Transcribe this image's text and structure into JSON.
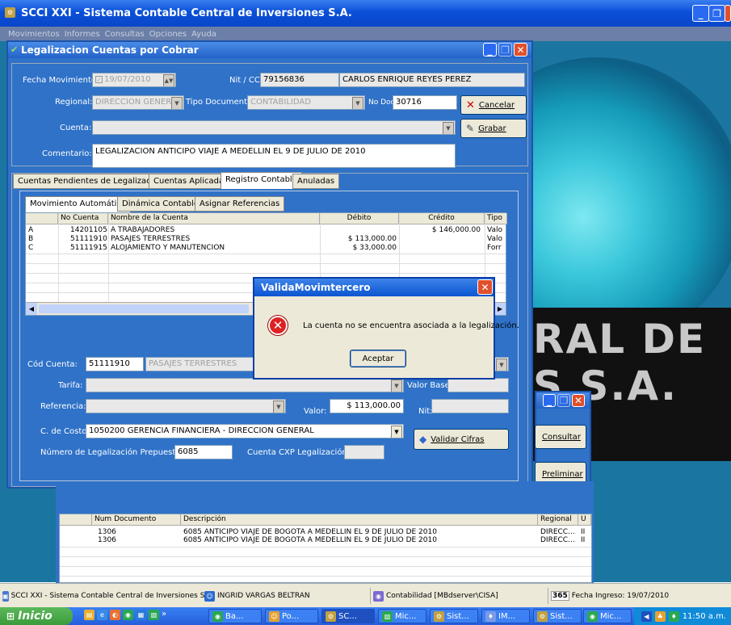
{
  "app_title": "SCCI XXI - Sistema Contable Central de Inversiones S.A.",
  "menu": [
    "Movimientos",
    "Informes",
    "Consultas",
    "Opciones",
    "Ayuda"
  ],
  "background_text": {
    "line1": "RAL DE",
    "line2": "S S.A."
  },
  "legal_window": {
    "title": "Legalizacion Cuentas por Cobrar",
    "fecha_label": "Fecha Movimiento:",
    "fecha_value": "19/07/2010",
    "nit_label": "Nit / CC:",
    "nit_value": "79156836",
    "nombre_value": "CARLOS ENRIQUE REYES PEREZ",
    "regional_label": "Regional:",
    "regional_value": "DIRECCION GENERAL",
    "tipo_doc_label": "Tipo Documento:",
    "tipo_doc_value": "CONTABILIDAD",
    "no_doc_label": "No Doc.",
    "no_doc_value": "30716",
    "cancelar_label": "Cancelar",
    "cuenta_label": "Cuenta:",
    "grabar_label": "Grabar",
    "comentario_label": "Comentario:",
    "comentario_value": "LEGALIZACION ANTICIPO VIAJE A MEDELLIN EL 9 DE JULIO DE 2010",
    "tabs": [
      "Cuentas Pendientes de Legalización",
      "Cuentas Aplicadas",
      "Registro Contable",
      "Anuladas"
    ],
    "subtabs": [
      "Movimiento Automático",
      "Dinámica Contable",
      "Asignar Referencias"
    ],
    "grid": {
      "headers": [
        "",
        "No Cuenta",
        "Nombre de la Cuenta",
        "Débito",
        "Crédito",
        "Tipo"
      ],
      "rows": [
        [
          "A",
          "14201105",
          "A TRABAJADORES",
          "",
          "$ 146,000.00",
          "Valo"
        ],
        [
          "B",
          "51111910",
          "PASAJES TERRESTRES",
          "$ 113,000.00",
          "",
          "Valo"
        ],
        [
          "C",
          "51111915",
          "ALOJAMIENTO Y MANUTENCION",
          "$ 33,000.00",
          "",
          "Forr"
        ]
      ]
    },
    "cod_cuenta_label": "Cód Cuenta:",
    "cod_cuenta_value": "51111910",
    "cod_cuenta_name": "PASAJES TERRESTRES",
    "tarifa_label": "Tarifa:",
    "valor_base_label": "Valor Base:",
    "referencia_label": "Referencia:",
    "valor_label": "Valor:",
    "valor_value": "$ 113,000.00",
    "nit2_label": "Nit:",
    "costo_label": "C. de Costo:",
    "costo_value": "1050200 GERENCIA FINANCIERA - DIRECCION GENERAL",
    "validar_label": "Validar Cifras",
    "num_legal_label": "Número de Legalización Prepuestal:",
    "num_legal_value": "6085",
    "cxp_label": "Cuenta CXP Legalización:"
  },
  "dialog": {
    "title": "ValidaMovimtercero",
    "message": "La cuenta no se encuentra asociada a la legalización.",
    "ok_label": "Aceptar"
  },
  "win2": {
    "consultar_label": "Consultar",
    "preliminar_label": "Preliminar"
  },
  "bottom_grid": {
    "headers": [
      "",
      "Num Documento",
      "Descripción",
      "Regional",
      "U"
    ],
    "rows": [
      [
        "1306",
        "6085 ANTICIPO VIAJE DE BOGOTA A MEDELLIN EL 9 DE JULIO DE 2010",
        "DIRECC...",
        "II"
      ],
      [
        "1306",
        "6085 ANTICIPO VIAJE DE BOGOTA A MEDELLIN EL 9 DE JULIO DE 2010",
        "DIRECC...",
        "II"
      ]
    ]
  },
  "statusbar": {
    "app": "SCCI XXI - Sistema Contable Central de Inversiones S",
    "user": "INGRID VARGAS BELTRAN",
    "db": "Contabilidad [MBdserver\\CISA]",
    "day": "365",
    "fecha": "Fecha Ingreso: 19/07/2010"
  },
  "taskbar": {
    "start": "Inicio",
    "tasks": [
      "Ba...",
      "Po...",
      "SC...",
      "Mic...",
      "Sist...",
      "IM...",
      "Sist...",
      "Mic..."
    ],
    "clock": "11:50 a.m."
  }
}
